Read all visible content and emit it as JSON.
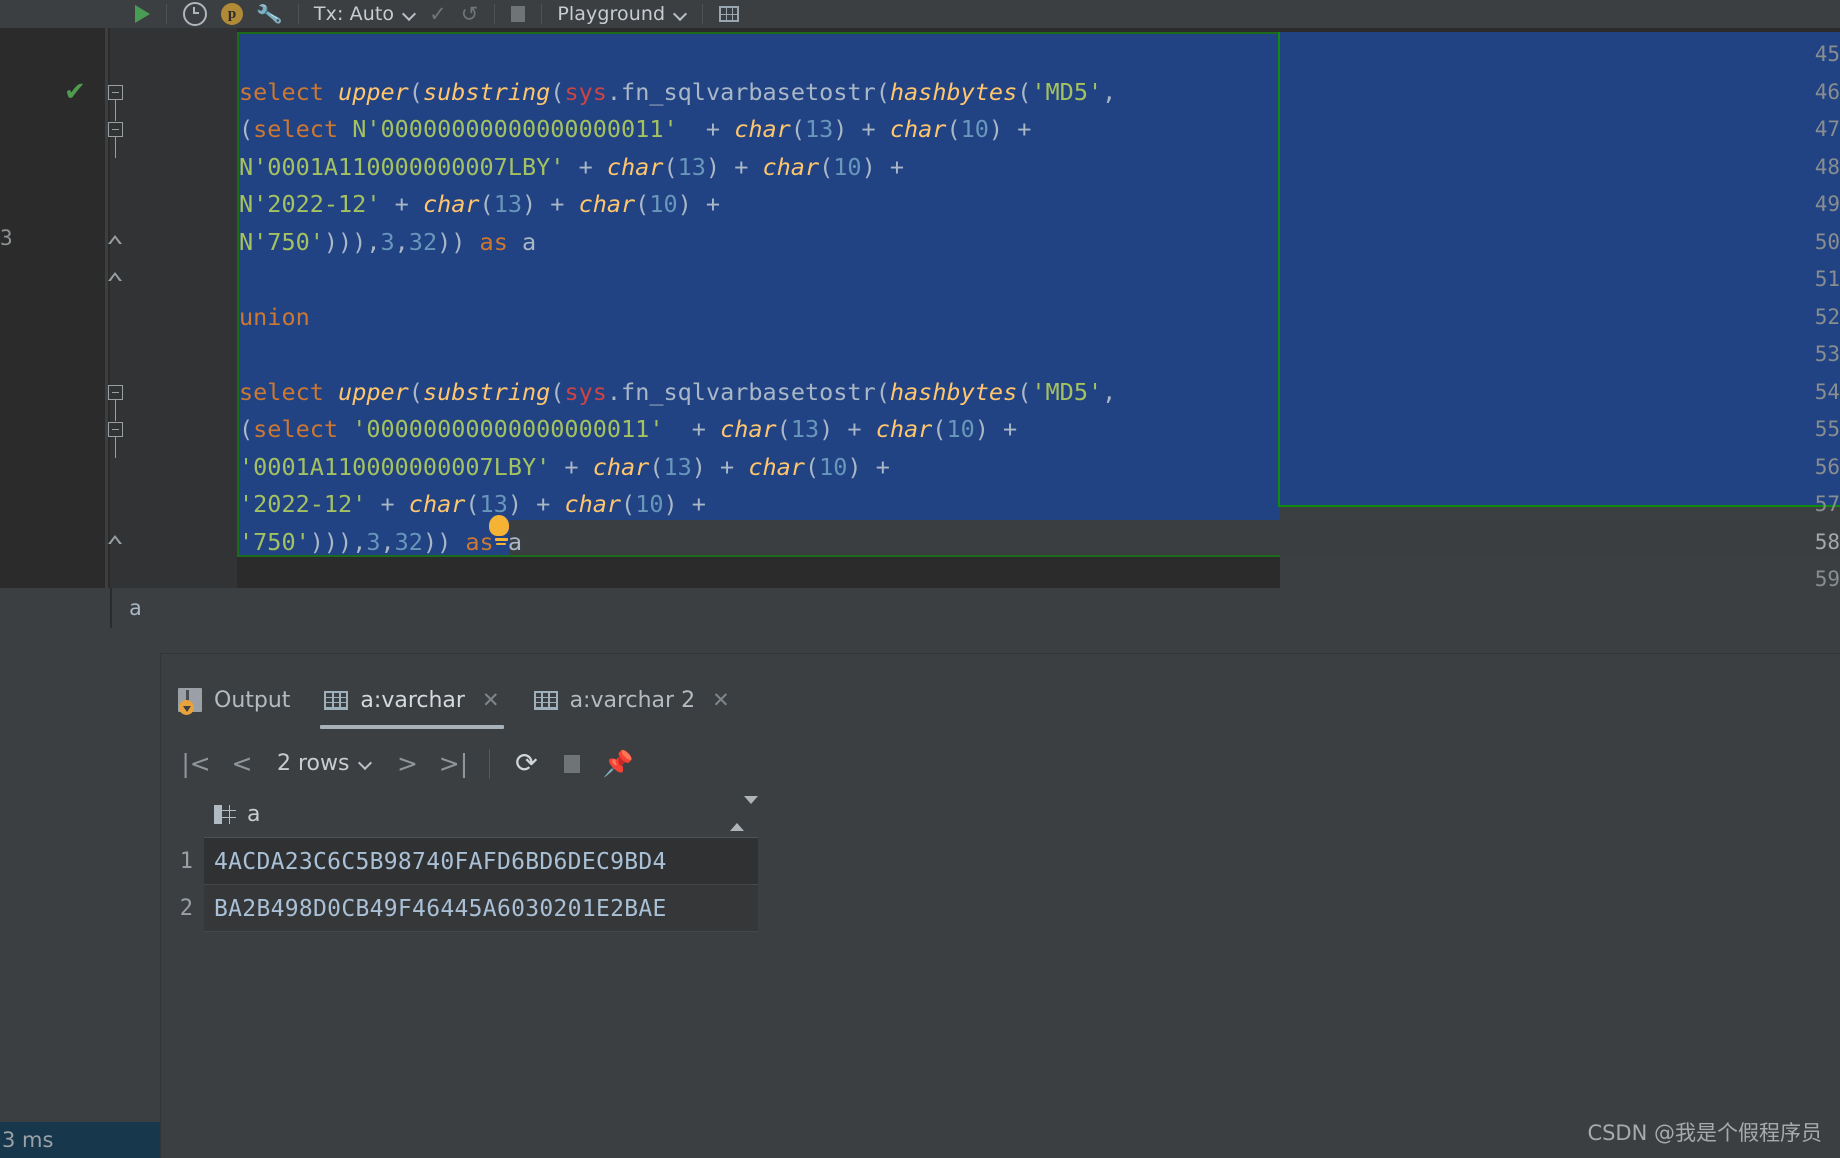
{
  "toolbar": {
    "run_label": "run-query",
    "history_label": "query-history",
    "profile_label": "p",
    "settings_label": "settings",
    "tx_label": "Tx: Auto",
    "commit_label": "commit",
    "rollback_label": "rollback",
    "stop_label": "stop",
    "schema_label": "Playground",
    "grid_label": "open-in-grid"
  },
  "editor": {
    "edge_line_number": "3",
    "current_line": 58,
    "lines": [
      {
        "num": "45",
        "tokens": []
      },
      {
        "num": "46",
        "check": true,
        "fold": "box",
        "tokens": [
          {
            "t": "select ",
            "c": "kw"
          },
          {
            "t": "upper",
            "c": "fn"
          },
          {
            "t": "(",
            "c": "pn"
          },
          {
            "t": "substring",
            "c": "fn"
          },
          {
            "t": "(",
            "c": "pn"
          },
          {
            "t": "sys",
            "c": "sch"
          },
          {
            "t": ".fn_sqlvarbasetostr",
            "c": "id"
          },
          {
            "t": "(",
            "c": "pn"
          },
          {
            "t": "hashbytes",
            "c": "fn"
          },
          {
            "t": "(",
            "c": "pn"
          },
          {
            "t": "'MD5'",
            "c": "str"
          },
          {
            "t": ",",
            "c": "pn"
          }
        ]
      },
      {
        "num": "47",
        "fold": "box",
        "tokens": [
          {
            "t": "(",
            "c": "pn"
          },
          {
            "t": "select ",
            "c": "kw"
          },
          {
            "t": "N'00000000000000000011'",
            "c": "str"
          },
          {
            "t": "  + ",
            "c": "pn"
          },
          {
            "t": "char",
            "c": "fn"
          },
          {
            "t": "(",
            "c": "pn"
          },
          {
            "t": "13",
            "c": "num"
          },
          {
            "t": ") + ",
            "c": "pn"
          },
          {
            "t": "char",
            "c": "fn"
          },
          {
            "t": "(",
            "c": "pn"
          },
          {
            "t": "10",
            "c": "num"
          },
          {
            "t": ") +",
            "c": "pn"
          }
        ]
      },
      {
        "num": "48",
        "tokens": [
          {
            "t": "N'0001A110000000007LBY'",
            "c": "str"
          },
          {
            "t": " + ",
            "c": "pn"
          },
          {
            "t": "char",
            "c": "fn"
          },
          {
            "t": "(",
            "c": "pn"
          },
          {
            "t": "13",
            "c": "num"
          },
          {
            "t": ") + ",
            "c": "pn"
          },
          {
            "t": "char",
            "c": "fn"
          },
          {
            "t": "(",
            "c": "pn"
          },
          {
            "t": "10",
            "c": "num"
          },
          {
            "t": ") +",
            "c": "pn"
          }
        ]
      },
      {
        "num": "49",
        "tokens": [
          {
            "t": "N'2022-12'",
            "c": "str"
          },
          {
            "t": " + ",
            "c": "pn"
          },
          {
            "t": "char",
            "c": "fn"
          },
          {
            "t": "(",
            "c": "pn"
          },
          {
            "t": "13",
            "c": "num"
          },
          {
            "t": ") + ",
            "c": "pn"
          },
          {
            "t": "char",
            "c": "fn"
          },
          {
            "t": "(",
            "c": "pn"
          },
          {
            "t": "10",
            "c": "num"
          },
          {
            "t": ") +",
            "c": "pn"
          }
        ]
      },
      {
        "num": "50",
        "fold": "tri",
        "tokens": [
          {
            "t": "N'750'",
            "c": "str"
          },
          {
            "t": "))),",
            "c": "pn"
          },
          {
            "t": "3",
            "c": "num"
          },
          {
            "t": ",",
            "c": "pn"
          },
          {
            "t": "32",
            "c": "num"
          },
          {
            "t": ")) ",
            "c": "pn"
          },
          {
            "t": "as ",
            "c": "kw"
          },
          {
            "t": "a",
            "c": "id"
          }
        ]
      },
      {
        "num": "51",
        "fold": "tri",
        "tokens": []
      },
      {
        "num": "52",
        "tokens": [
          {
            "t": "union",
            "c": "kw"
          }
        ]
      },
      {
        "num": "53",
        "tokens": []
      },
      {
        "num": "54",
        "fold": "box",
        "tokens": [
          {
            "t": "select ",
            "c": "kw"
          },
          {
            "t": "upper",
            "c": "fn"
          },
          {
            "t": "(",
            "c": "pn"
          },
          {
            "t": "substring",
            "c": "fn"
          },
          {
            "t": "(",
            "c": "pn"
          },
          {
            "t": "sys",
            "c": "sch"
          },
          {
            "t": ".fn_sqlvarbasetostr",
            "c": "id"
          },
          {
            "t": "(",
            "c": "pn"
          },
          {
            "t": "hashbytes",
            "c": "fn"
          },
          {
            "t": "(",
            "c": "pn"
          },
          {
            "t": "'MD5'",
            "c": "str"
          },
          {
            "t": ",",
            "c": "pn"
          }
        ]
      },
      {
        "num": "55",
        "fold": "box",
        "tokens": [
          {
            "t": "(",
            "c": "pn"
          },
          {
            "t": "select ",
            "c": "kw"
          },
          {
            "t": "'00000000000000000011'",
            "c": "str"
          },
          {
            "t": "  + ",
            "c": "pn"
          },
          {
            "t": "char",
            "c": "fn"
          },
          {
            "t": "(",
            "c": "pn"
          },
          {
            "t": "13",
            "c": "num"
          },
          {
            "t": ") + ",
            "c": "pn"
          },
          {
            "t": "char",
            "c": "fn"
          },
          {
            "t": "(",
            "c": "pn"
          },
          {
            "t": "10",
            "c": "num"
          },
          {
            "t": ") +",
            "c": "pn"
          }
        ]
      },
      {
        "num": "56",
        "tokens": [
          {
            "t": "'0001A110000000007LBY'",
            "c": "str"
          },
          {
            "t": " + ",
            "c": "pn"
          },
          {
            "t": "char",
            "c": "fn"
          },
          {
            "t": "(",
            "c": "pn"
          },
          {
            "t": "13",
            "c": "num"
          },
          {
            "t": ") + ",
            "c": "pn"
          },
          {
            "t": "char",
            "c": "fn"
          },
          {
            "t": "(",
            "c": "pn"
          },
          {
            "t": "10",
            "c": "num"
          },
          {
            "t": ") +",
            "c": "pn"
          }
        ]
      },
      {
        "num": "57",
        "bulb": true,
        "tokens": [
          {
            "t": "'2022-12'",
            "c": "str"
          },
          {
            "t": " + ",
            "c": "pn"
          },
          {
            "t": "char",
            "c": "fn"
          },
          {
            "t": "(",
            "c": "pn"
          },
          {
            "t": "13",
            "c": "num"
          },
          {
            "t": ") + ",
            "c": "pn"
          },
          {
            "t": "char",
            "c": "fn"
          },
          {
            "t": "(",
            "c": "pn"
          },
          {
            "t": "10",
            "c": "num"
          },
          {
            "t": ") +",
            "c": "pn"
          }
        ]
      },
      {
        "num": "58",
        "fold": "tri",
        "current": true,
        "tokens": [
          {
            "t": "'750'",
            "c": "str"
          },
          {
            "t": "))),",
            "c": "pn"
          },
          {
            "t": "3",
            "c": "num"
          },
          {
            "t": ",",
            "c": "pn"
          },
          {
            "t": "32",
            "c": "num"
          },
          {
            "t": ")) ",
            "c": "pn"
          },
          {
            "t": "as ",
            "c": "kw"
          },
          {
            "t": "a",
            "c": "id"
          }
        ]
      },
      {
        "num": "59",
        "tokens": []
      }
    ],
    "status_column": "a"
  },
  "panel": {
    "tabs": [
      {
        "label": "Output",
        "icon": "output-icon",
        "active": false,
        "closable": false
      },
      {
        "label": "a:varchar",
        "icon": "table-icon",
        "active": true,
        "closable": true
      },
      {
        "label": "a:varchar 2",
        "icon": "table-icon",
        "active": false,
        "closable": true
      }
    ],
    "grid_toolbar": {
      "first_page": "|<",
      "prev_page": "<",
      "rows_label": "2 rows",
      "next_page": ">",
      "last_page": ">|",
      "refresh": "refresh-icon",
      "stop": "stop-icon",
      "pin": "pin-icon"
    },
    "grid": {
      "columns": [
        "a"
      ],
      "rows": [
        {
          "num": "1",
          "values": [
            "4ACDA23C6C5B98740FAFD6BD6DEC9BD4"
          ]
        },
        {
          "num": "2",
          "values": [
            "BA2B498D0CB49F46445A6030201E2BAE"
          ]
        }
      ]
    }
  },
  "notification": {
    "text": "3 ms"
  },
  "watermark": {
    "text": "CSDN @我是个假程序员"
  }
}
